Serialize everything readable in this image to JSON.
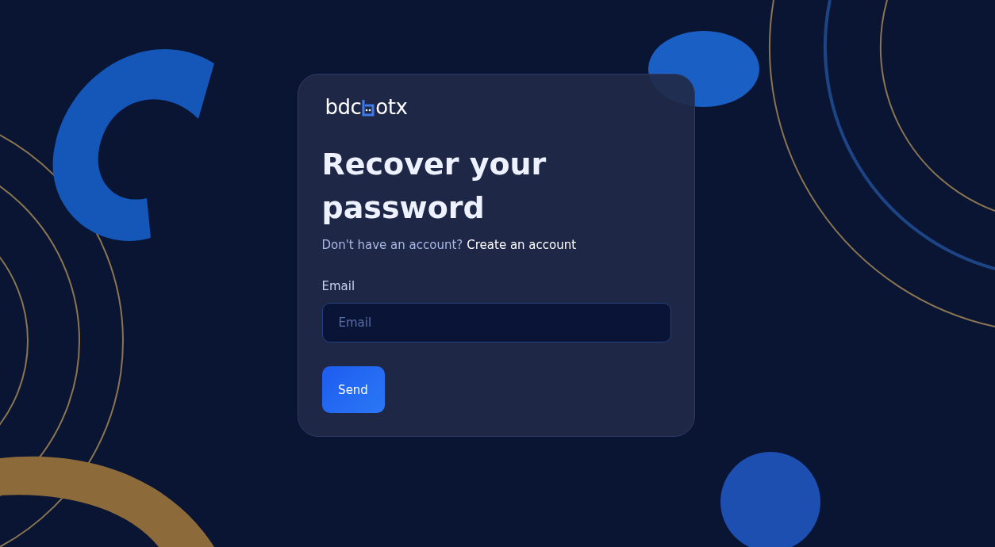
{
  "logo": {
    "prefix": "bdc",
    "suffix": "otx"
  },
  "heading": "Recover your password",
  "signup_prompt": {
    "text": "Don't have an account?",
    "link": "Create an account"
  },
  "email_field": {
    "label": "Email",
    "placeholder": "Email"
  },
  "send_button": "Send"
}
